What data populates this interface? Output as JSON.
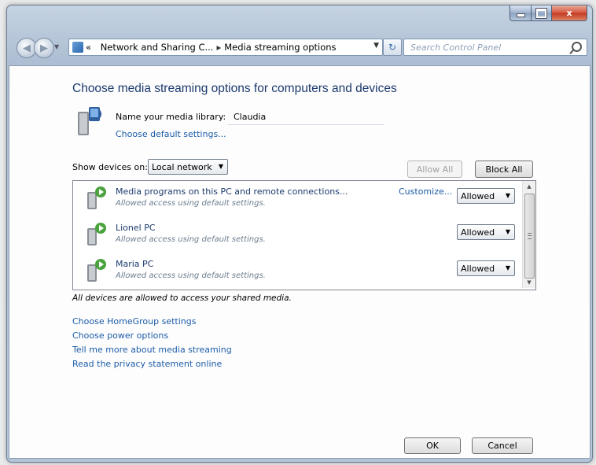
{
  "window": {
    "buttons": {
      "minimize": "–",
      "maximize": "□",
      "close": "x"
    }
  },
  "address_bar": {
    "prefix": "«",
    "crumbs": [
      "Network and Sharing C...",
      "Media streaming options"
    ],
    "separator": "▸",
    "search_placeholder": "Search Control Panel"
  },
  "main": {
    "heading": "Choose media streaming options for computers and devices",
    "library_label": "Name your media library:",
    "library_name": "Claudia",
    "default_settings_link": "Choose default settings...",
    "show_devices_label": "Show devices on:",
    "network_select": "Local network",
    "allow_all": "Allow All",
    "block_all": "Block All",
    "devices": [
      {
        "name": "Media programs on this PC and remote connections...",
        "status": "Allowed access using default settings.",
        "customize": "Customize...",
        "access": "Allowed"
      },
      {
        "name": "Lionel PC",
        "status": "Allowed access using default settings.",
        "access": "Allowed"
      },
      {
        "name": "Maria PC",
        "status": "Allowed access using default settings.",
        "access": "Allowed"
      }
    ],
    "all_allowed_note": "All devices are allowed to access your shared media.",
    "links": [
      "Choose HomeGroup settings",
      "Choose power options",
      "Tell me more about media streaming",
      "Read the privacy statement online"
    ],
    "ok": "OK",
    "cancel": "Cancel"
  },
  "colors": {
    "heading": "#1c3a6e",
    "link": "#1c5ca8",
    "status_text": "#6b7c8e",
    "frame": "#b7c7d9"
  }
}
